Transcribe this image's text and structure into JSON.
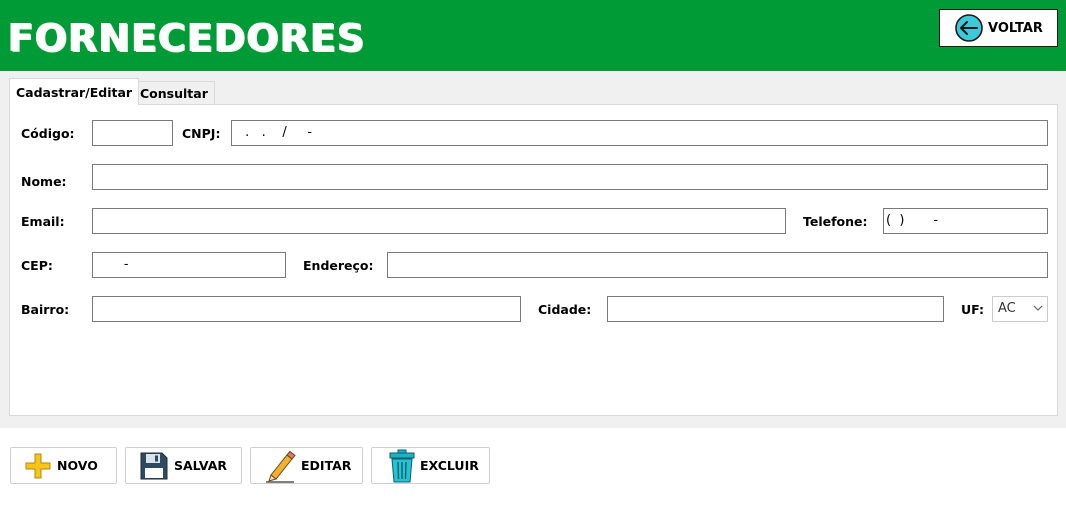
{
  "header": {
    "title": "FORNECEDORES",
    "back_label": "VOLTAR",
    "back_icon": "arrow-left-circle-icon",
    "color": "#009a36"
  },
  "tabs": [
    {
      "label": "Cadastrar/Editar",
      "active": true
    },
    {
      "label": "Consultar",
      "active": false
    }
  ],
  "form": {
    "codigo_label": "Código:",
    "codigo_value": "",
    "cnpj_label": "CNPJ:",
    "cnpj_value": " .   .    /     -",
    "nome_label": "Nome:",
    "nome_value": "",
    "email_label": "Email:",
    "email_value": "",
    "telefone_label": "Telefone:",
    "telefone_value": "(  )       -",
    "cep_label": "CEP:",
    "cep_value": "       -",
    "endereco_label": "Endereço:",
    "endereco_value": "",
    "bairro_label": "Bairro:",
    "bairro_value": "",
    "cidade_label": "Cidade:",
    "cidade_value": "",
    "uf_label": "UF:",
    "uf_value": "AC"
  },
  "actions": {
    "novo": {
      "label": "NOVO",
      "icon": "plus-icon"
    },
    "salvar": {
      "label": "SALVAR",
      "icon": "floppy-disk-icon"
    },
    "editar": {
      "label": "EDITAR",
      "icon": "pencil-icon"
    },
    "excluir": {
      "label": "EXCLUIR",
      "icon": "trash-icon"
    }
  }
}
